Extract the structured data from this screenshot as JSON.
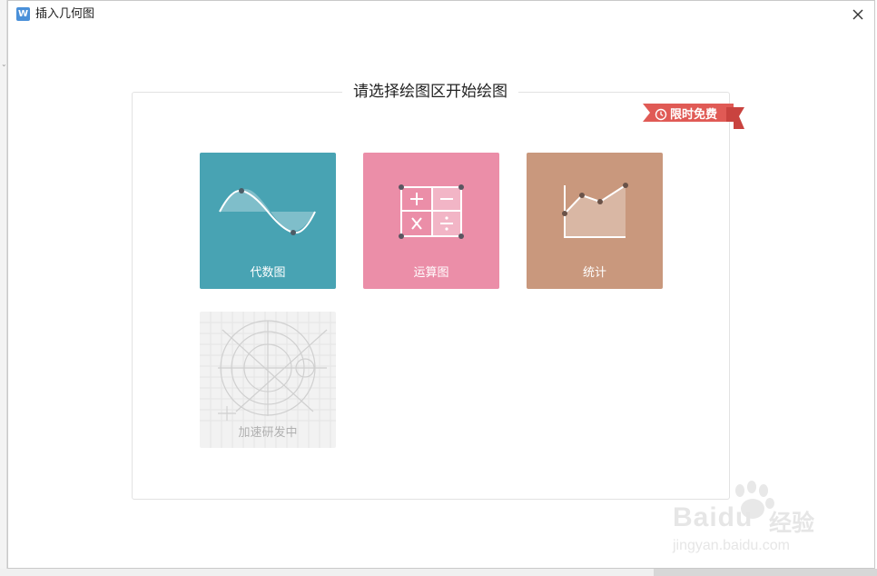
{
  "window": {
    "title": "插入几何图",
    "app_icon_letter": "W",
    "close_symbol": "✕"
  },
  "panel": {
    "title": "请选择绘图区开始绘图",
    "badge": "限时免费",
    "badge_color": "#e05a55"
  },
  "tiles": [
    {
      "label": "代数图",
      "icon": "sine-wave-icon",
      "color": "#48a3b3"
    },
    {
      "label": "运算图",
      "icon": "calculator-grid-icon",
      "color": "#eb8ea8"
    },
    {
      "label": "统计",
      "icon": "line-chart-icon",
      "color": "#c9987d"
    },
    {
      "label": "加速研发中",
      "icon": "geometry-sketch-icon",
      "color": "#f2f2f2",
      "disabled": true
    }
  ],
  "watermark": {
    "brand": "Baidu",
    "brand_suffix": "经验",
    "url": "jingyan.baidu.com"
  }
}
